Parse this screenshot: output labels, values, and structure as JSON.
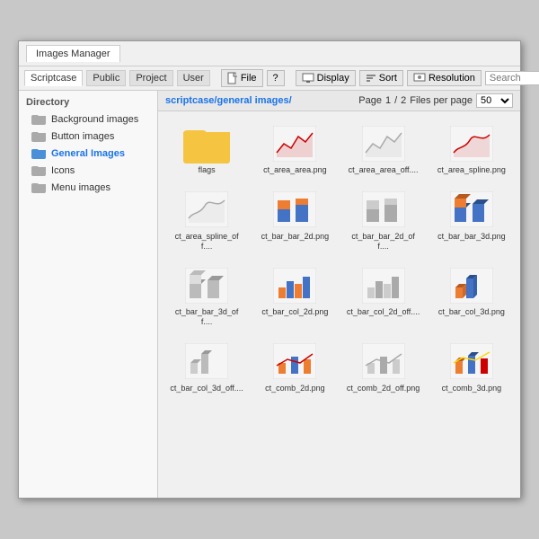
{
  "window": {
    "title": "Images Manager"
  },
  "toolbar_tabs": [
    "Scriptcase",
    "Public",
    "Project",
    "User"
  ],
  "active_tab": "Scriptcase",
  "toolbar_buttons": [
    {
      "label": "File",
      "icon": "file-icon"
    },
    {
      "label": "?",
      "icon": "help-icon"
    },
    {
      "label": "Display",
      "icon": "display-icon"
    },
    {
      "label": "Sort",
      "icon": "sort-icon"
    },
    {
      "label": "Resolution",
      "icon": "resolution-icon"
    }
  ],
  "search": {
    "placeholder": "Search",
    "label": "Search"
  },
  "sidebar": {
    "header": "Directory",
    "items": [
      {
        "label": "Background images",
        "active": false
      },
      {
        "label": "Button images",
        "active": false
      },
      {
        "label": "General Images",
        "active": true
      },
      {
        "label": "Icons",
        "active": false
      },
      {
        "label": "Menu images",
        "active": false
      }
    ]
  },
  "content": {
    "path": "scriptcase/general images/",
    "page_label": "Page",
    "page_current": "1",
    "page_total": "2",
    "files_per_page_label": "Files per page",
    "files_per_page_value": "50",
    "files": [
      {
        "name": "flags",
        "type": "folder"
      },
      {
        "name": "ct_area_area.png",
        "type": "area_area"
      },
      {
        "name": "ct_area_area_off....",
        "type": "area_area_off"
      },
      {
        "name": "ct_area_spline.png",
        "type": "area_spline"
      },
      {
        "name": "ct_area_spline_off....",
        "type": "area_spline_off"
      },
      {
        "name": "ct_bar_bar_2d.png",
        "type": "bar_bar_2d"
      },
      {
        "name": "ct_bar_bar_2d_off....",
        "type": "bar_bar_2d_off"
      },
      {
        "name": "ct_bar_bar_3d.png",
        "type": "bar_bar_3d"
      },
      {
        "name": "ct_bar_bar_3d_off....",
        "type": "bar_bar_3d_off"
      },
      {
        "name": "ct_bar_col_2d.png",
        "type": "bar_col_2d"
      },
      {
        "name": "ct_bar_col_2d_off....",
        "type": "bar_col_2d_off"
      },
      {
        "name": "ct_bar_col_3d.png",
        "type": "bar_col_3d"
      },
      {
        "name": "ct_bar_col_3d_off....",
        "type": "bar_col_3d_off"
      },
      {
        "name": "ct_comb_2d.png",
        "type": "comb_2d"
      },
      {
        "name": "ct_comb_2d_off.png",
        "type": "comb_2d_off"
      },
      {
        "name": "ct_comb_3d.png",
        "type": "comb_3d"
      }
    ]
  }
}
